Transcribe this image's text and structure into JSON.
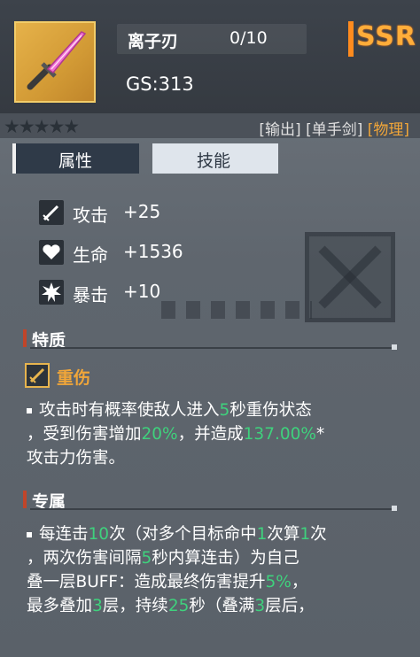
{
  "header": {
    "item_name": "离子刃",
    "item_count": "0/10",
    "gs": "GS:313",
    "rarity": "SSR"
  },
  "stars": "★★★★★",
  "tags": {
    "t1": "[输出]",
    "t2": "[单手剑]",
    "t3": "[物理]"
  },
  "tabs": {
    "attr": "属性",
    "skill": "技能"
  },
  "stats": [
    {
      "label": "攻击",
      "value": "+25"
    },
    {
      "label": "生命",
      "value": "+1536"
    },
    {
      "label": "暴击",
      "value": "+10"
    }
  ],
  "trait": {
    "section_title": "特质",
    "name": "重伤",
    "line1a": "攻击时有概率使敌人进入",
    "line1b": "5",
    "line1c": "秒重伤状态",
    "line2a": "，受到伤害增加",
    "line2b": "20%",
    "line2c": "，并造成",
    "line2d": "137.00%",
    "line2e": "*",
    "line3": "攻击力伤害。"
  },
  "exclusive": {
    "section_title": "专属",
    "l1a": "每连击",
    "l1b": "10",
    "l1c": "次（对多个目标命中",
    "l1d": "1",
    "l1e": "次算",
    "l1f": "1",
    "l1g": "次",
    "l2a": "，两次伤害间隔",
    "l2b": "5",
    "l2c": "秒内算连击）为自己",
    "l3a": "叠一层BUFF：造成最终伤害提升",
    "l3b": "5%",
    "l3c": "，",
    "l4a": "最多叠加",
    "l4b": "3",
    "l4c": "层，持续",
    "l4d": "25",
    "l4e": "秒（叠满",
    "l4f": "3",
    "l4g": "层后，"
  },
  "colors": {
    "accent_orange": "#f1a639",
    "number_green": "#3fd17d",
    "rarity": "#ffad3a"
  }
}
